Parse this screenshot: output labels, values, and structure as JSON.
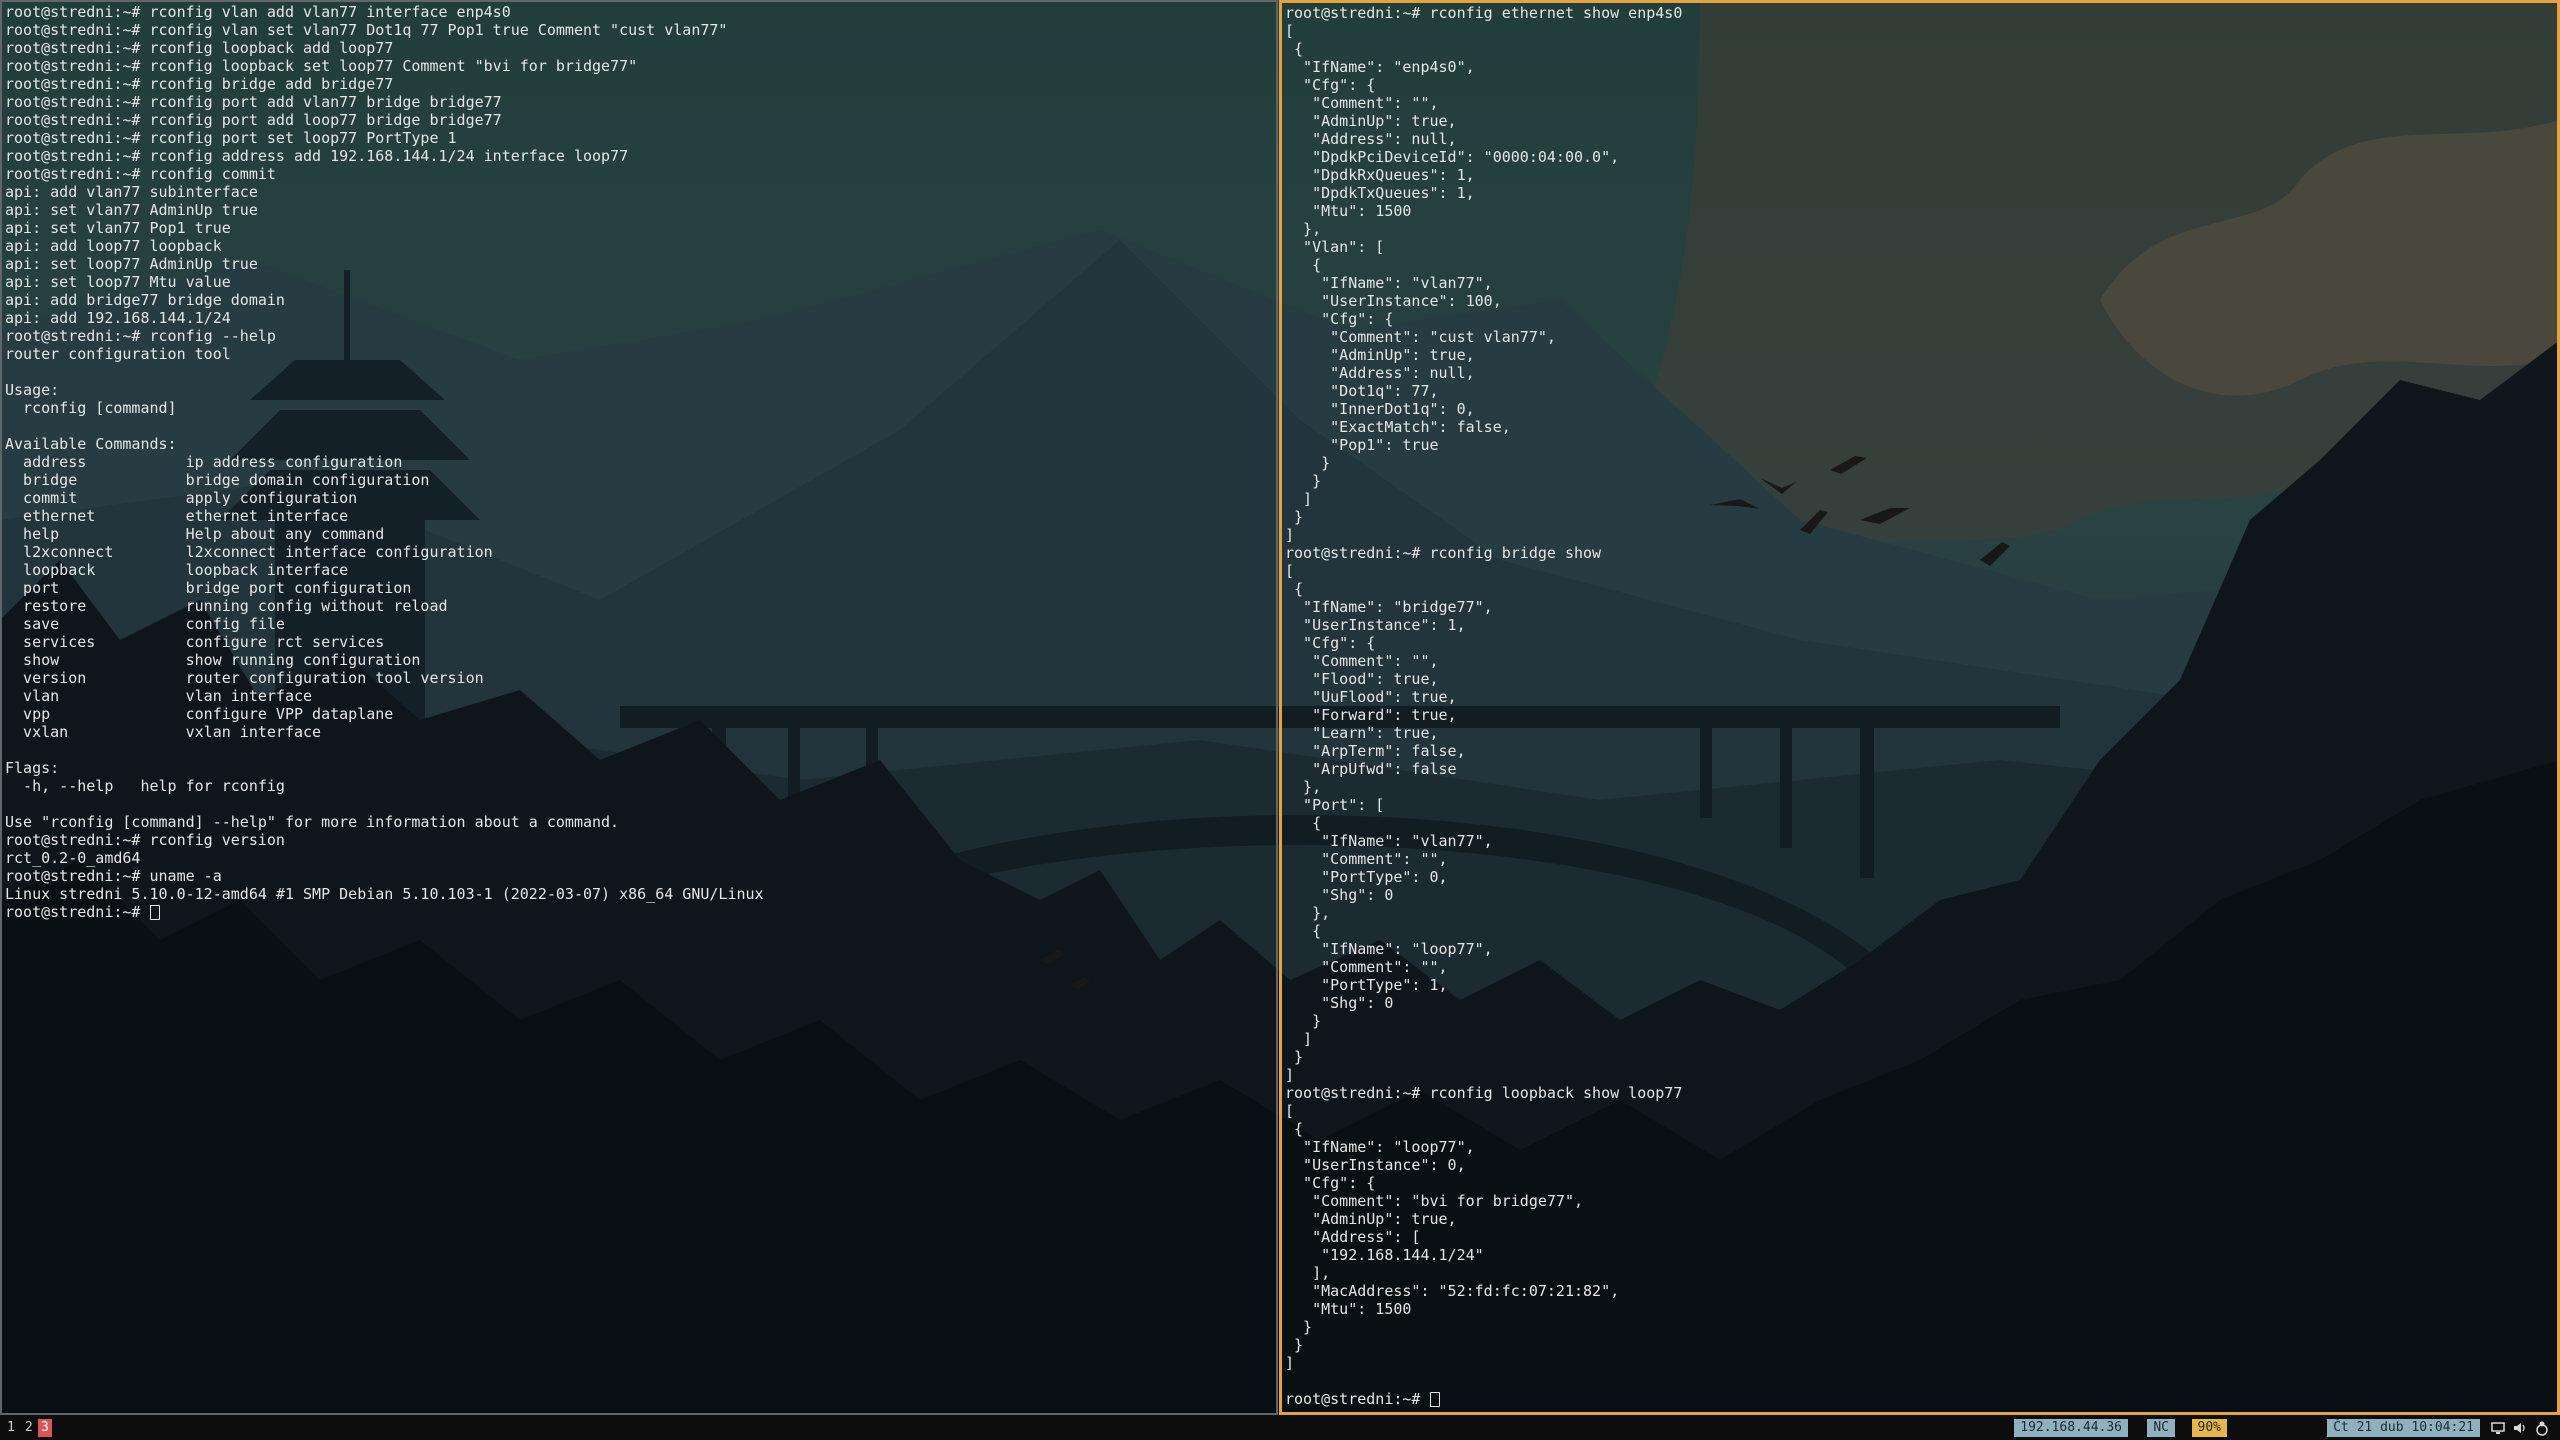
{
  "terminals": {
    "left": {
      "lines": [
        "root@stredni:~# rconfig vlan add vlan77 interface enp4s0",
        "root@stredni:~# rconfig vlan set vlan77 Dot1q 77 Pop1 true Comment \"cust vlan77\"",
        "root@stredni:~# rconfig loopback add loop77",
        "root@stredni:~# rconfig loopback set loop77 Comment \"bvi for bridge77\"",
        "root@stredni:~# rconfig bridge add bridge77",
        "root@stredni:~# rconfig port add vlan77 bridge bridge77",
        "root@stredni:~# rconfig port add loop77 bridge bridge77",
        "root@stredni:~# rconfig port set loop77 PortType 1",
        "root@stredni:~# rconfig address add 192.168.144.1/24 interface loop77",
        "root@stredni:~# rconfig commit",
        "api: add vlan77 subinterface",
        "api: set vlan77 AdminUp true",
        "api: set vlan77 Pop1 true",
        "api: add loop77 loopback",
        "api: set loop77 AdminUp true",
        "api: set loop77 Mtu value",
        "api: add bridge77 bridge domain",
        "api: add 192.168.144.1/24",
        "root@stredni:~# rconfig --help",
        "router configuration tool",
        "",
        "Usage:",
        "  rconfig [command]",
        "",
        "Available Commands:",
        "  address           ip address configuration",
        "  bridge            bridge domain configuration",
        "  commit            apply configuration",
        "  ethernet          ethernet interface",
        "  help              Help about any command",
        "  l2xconnect        l2xconnect interface configuration",
        "  loopback          loopback interface",
        "  port              bridge port configuration",
        "  restore           running config without reload",
        "  save              config file",
        "  services          configure rct services",
        "  show              show running configuration",
        "  version           router configuration tool version",
        "  vlan              vlan interface",
        "  vpp               configure VPP dataplane",
        "  vxlan             vxlan interface",
        "",
        "Flags:",
        "  -h, --help   help for rconfig",
        "",
        "Use \"rconfig [command] --help\" for more information about a command.",
        "root@stredni:~# rconfig version",
        "rct_0.2-0_amd64",
        "root@stredni:~# uname -a",
        "Linux stredni 5.10.0-12-amd64 #1 SMP Debian 5.10.103-1 (2022-03-07) x86_64 GNU/Linux"
      ],
      "prompt": "root@stredni:~# "
    },
    "right": {
      "lines": [
        "root@stredni:~# rconfig ethernet show enp4s0",
        "[",
        " {",
        "  \"IfName\": \"enp4s0\",",
        "  \"Cfg\": {",
        "   \"Comment\": \"\",",
        "   \"AdminUp\": true,",
        "   \"Address\": null,",
        "   \"DpdkPciDeviceId\": \"0000:04:00.0\",",
        "   \"DpdkRxQueues\": 1,",
        "   \"DpdkTxQueues\": 1,",
        "   \"Mtu\": 1500",
        "  },",
        "  \"Vlan\": [",
        "   {",
        "    \"IfName\": \"vlan77\",",
        "    \"UserInstance\": 100,",
        "    \"Cfg\": {",
        "     \"Comment\": \"cust vlan77\",",
        "     \"AdminUp\": true,",
        "     \"Address\": null,",
        "     \"Dot1q\": 77,",
        "     \"InnerDot1q\": 0,",
        "     \"ExactMatch\": false,",
        "     \"Pop1\": true",
        "    }",
        "   }",
        "  ]",
        " }",
        "]",
        "root@stredni:~# rconfig bridge show",
        "[",
        " {",
        "  \"IfName\": \"bridge77\",",
        "  \"UserInstance\": 1,",
        "  \"Cfg\": {",
        "   \"Comment\": \"\",",
        "   \"Flood\": true,",
        "   \"UuFlood\": true,",
        "   \"Forward\": true,",
        "   \"Learn\": true,",
        "   \"ArpTerm\": false,",
        "   \"ArpUfwd\": false",
        "  },",
        "  \"Port\": [",
        "   {",
        "    \"IfName\": \"vlan77\",",
        "    \"Comment\": \"\",",
        "    \"PortType\": 0,",
        "    \"Shg\": 0",
        "   },",
        "   {",
        "    \"IfName\": \"loop77\",",
        "    \"Comment\": \"\",",
        "    \"PortType\": 1,",
        "    \"Shg\": 0",
        "   }",
        "  ]",
        " }",
        "]",
        "root@stredni:~# rconfig loopback show loop77",
        "[",
        " {",
        "  \"IfName\": \"loop77\",",
        "  \"UserInstance\": 0,",
        "  \"Cfg\": {",
        "   \"Comment\": \"bvi for bridge77\",",
        "   \"AdminUp\": true,",
        "   \"Address\": [",
        "    \"192.168.144.1/24\"",
        "   ],",
        "   \"MacAddress\": \"52:fd:fc:07:21:82\",",
        "   \"Mtu\": 1500",
        "  }",
        " }",
        "]"
      ],
      "prompt": "root@stredni:~# "
    }
  },
  "statusbar": {
    "workspaces": [
      "1",
      "2",
      "3"
    ],
    "active_workspace": "3",
    "ip": "192.168.44.36",
    "network": "NC",
    "battery": "90%",
    "datetime": "Čt 21 dub 10:04:21",
    "tray_icons": [
      "display-icon",
      "volume-icon",
      "network-icon"
    ]
  },
  "colors": {
    "focused_border": "#e6a23c",
    "unfocused_border": "#5f676a",
    "terminal_text": "#e6e6e6",
    "statusbar_bg": "#0d0d0d",
    "workspace_active": "#d95558",
    "status_block": "#8fb0bf",
    "battery_block": "#e6b84b"
  }
}
